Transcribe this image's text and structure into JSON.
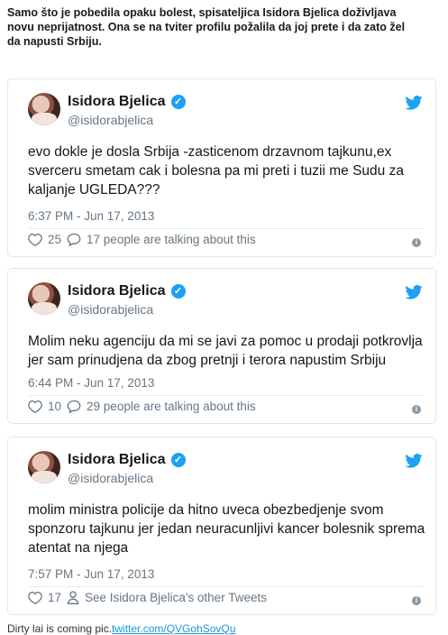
{
  "intro": {
    "line1": "Samo što je pobedila opaku bolest, spisateljica Isidora Bjelica doživljava",
    "line2": "novu neprijatnost. Ona se na tviter profilu požalila da joj prete i da zato žel",
    "line3": "da napusti Srbiju."
  },
  "tweets": [
    {
      "name": "Isidora Bjelica",
      "handle": "@isidorabjelica",
      "text": "evo dokle je dosla Srbija -zasticenom  drzavnom tajkunu,ex sverceru smetam cak i bolesna pa mi preti i tuzii me  Sudu za kaljanje UGLEDA???",
      "time": "6:37 PM - Jun 17, 2013",
      "likes": "25",
      "secondary": "17 people are talking about this"
    },
    {
      "name": "Isidora Bjelica",
      "handle": "@isidorabjelica",
      "text": "Molim neku agenciju da mi se javi za pomoc u prodaji potkrovlja jer sam prinudjena da zbog pretnji i terora napustim Srbiju",
      "time": "6:44 PM - Jun 17, 2013",
      "likes": "10",
      "secondary": "29 people are talking about this"
    },
    {
      "name": "Isidora Bjelica",
      "handle": "@isidorabjelica",
      "text": "molim ministra policije da hitno uveca obezbedjenje svom sponzoru tajkunu jer jedan neuracunljivi kancer bolesnik sprema atentat na njega",
      "time": "7:57 PM - Jun 17, 2013",
      "likes": "17",
      "secondary": "See Isidora Bjelica's other Tweets"
    }
  ],
  "footer": {
    "text": "Dirty lai is coming pic.",
    "link": "twitter.com/QVGohSovQu"
  },
  "colors": {
    "accent": "#1da1f2",
    "muted": "#657786"
  }
}
